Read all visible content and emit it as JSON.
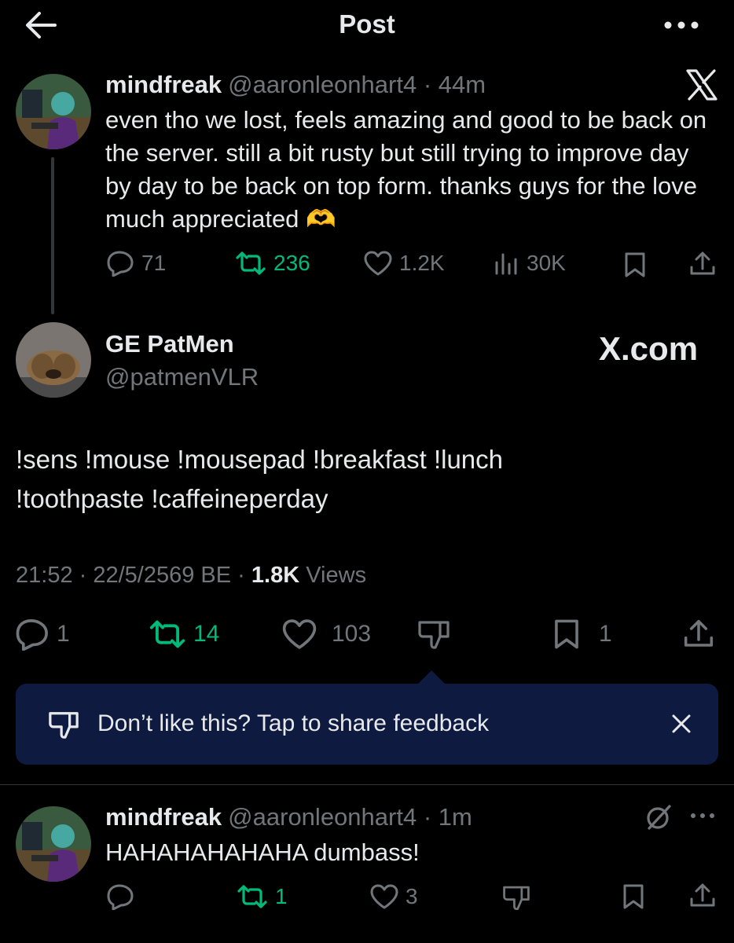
{
  "header": {
    "title": "Post"
  },
  "quoted_post": {
    "author_name": "mindfreak",
    "author_handle": "@aaronleonhart4",
    "time": "44m",
    "text": "even tho we lost, feels amazing and good to be back on the server. still a bit rusty but still trying to improve day by day to be back on top form. thanks guys for the love much appreciated 🫶",
    "replies": "71",
    "reposts": "236",
    "likes": "1.2K",
    "views": "30K",
    "badge_icon": "x-logo-icon"
  },
  "main_post": {
    "author_name": "GE PatMen",
    "author_handle": "@patmenVLR",
    "watermark": "X.com",
    "text": "!sens !mouse !mousepad !breakfast !lunch !toothpaste !caffeineperday",
    "time": "21:52",
    "date": "22/5/2569 BE",
    "views_count": "1.8K",
    "views_label": "Views",
    "replies": "1",
    "reposts": "14",
    "likes": "103",
    "bookmarks": "1"
  },
  "feedback": {
    "text": "Don’t like this? Tap to share feedback"
  },
  "reply": {
    "author_name": "mindfreak",
    "author_handle": "@aaronleonhart4",
    "time": "1m",
    "text": "HAHAHAHAHAHA dumbass!",
    "replies": "",
    "reposts": "1",
    "likes": "3"
  },
  "colors": {
    "background": "#000000",
    "text": "#e7e9ea",
    "muted": "#71767b",
    "repost_green": "#00ba7c",
    "feedback_bg": "#0e1a3f"
  }
}
